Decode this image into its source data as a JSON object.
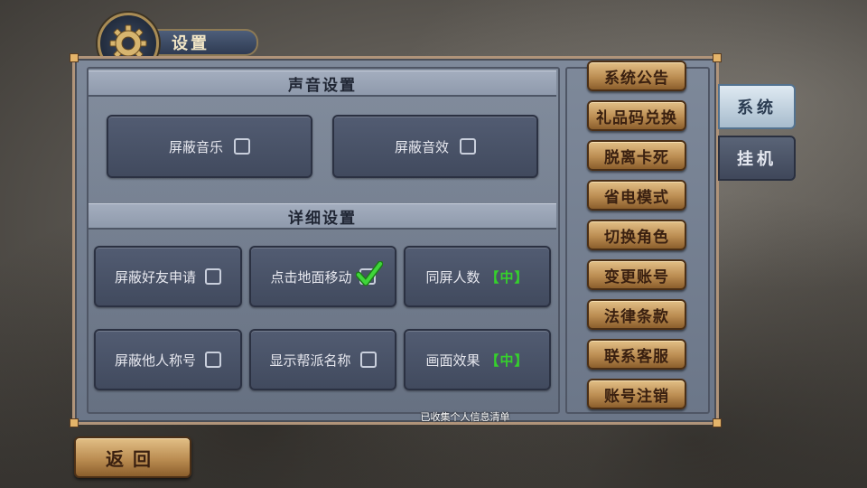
{
  "title": "设置",
  "sound_section": {
    "header": "声音设置",
    "options": [
      {
        "label": "屏蔽音乐",
        "checked": false
      },
      {
        "label": "屏蔽音效",
        "checked": false
      }
    ]
  },
  "detail_section": {
    "header": "详细设置",
    "options": [
      {
        "label": "屏蔽好友申请",
        "checked": false
      },
      {
        "label": "点击地面移动",
        "checked": true
      },
      {
        "label": "同屏人数",
        "level": "【中】"
      },
      {
        "label": "屏蔽他人称号",
        "checked": false
      },
      {
        "label": "显示帮派名称",
        "checked": false
      },
      {
        "label": "画面效果",
        "level": "【中】"
      }
    ]
  },
  "side_buttons": [
    "系统公告",
    "礼品码兑换",
    "脱离卡死",
    "省电模式",
    "切换角色",
    "变更账号",
    "法律条款",
    "联系客服",
    "账号注销"
  ],
  "tabs": [
    {
      "label": "系统",
      "active": true
    },
    {
      "label": "挂机",
      "active": false
    }
  ],
  "footer_link": "已收集个人信息清单",
  "back_button": "返回",
  "colors": {
    "accent_green": "#35d12c",
    "gold_button": "#c89a5c",
    "panel": "#6b7688",
    "option_bg": "#4a5368"
  },
  "icons": [
    "gear-icon",
    "checkmark-icon"
  ]
}
